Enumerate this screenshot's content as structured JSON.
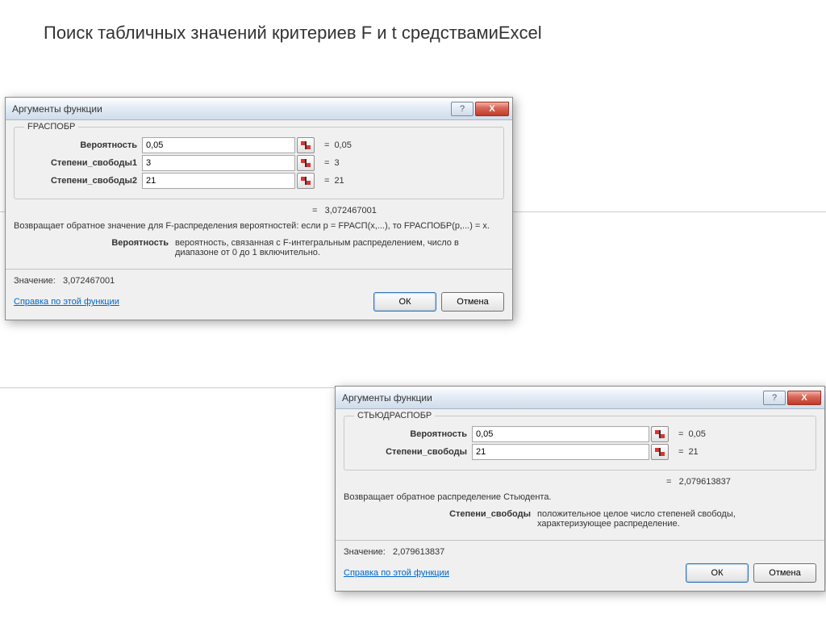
{
  "page_title": "Поиск табличных значений критериев F и t средствамиExcel",
  "dialog1": {
    "title": "Аргументы функции",
    "help_btn": "?",
    "close_btn": "X",
    "func_name": "FРАСПОБР",
    "args": [
      {
        "label": "Вероятность",
        "value": "0,05",
        "eval": "0,05"
      },
      {
        "label": "Степени_свободы1",
        "value": "3",
        "eval": "3"
      },
      {
        "label": "Степени_свободы2",
        "value": "21",
        "eval": "21"
      }
    ],
    "result_eq": "=",
    "result_inline": "3,072467001",
    "description": "Возвращает обратное значение для F-распределения вероятностей: если p = FРАСП(x,...), то FРАСПОБР(p,...) = x.",
    "param_help_label": "Вероятность",
    "param_help_text": "вероятность, связанная с F-интегральным распределением, число в диапазоне от 0 до 1 включительно.",
    "value_label": "Значение:",
    "value": "3,072467001",
    "help_link": "Справка по этой функции",
    "ok": "ОК",
    "cancel": "Отмена"
  },
  "dialog2": {
    "title": "Аргументы функции",
    "help_btn": "?",
    "close_btn": "X",
    "func_name": "СТЬЮДРАСПОБР",
    "args": [
      {
        "label": "Вероятность",
        "value": "0,05",
        "eval": "0,05"
      },
      {
        "label": "Степени_свободы",
        "value": "21",
        "eval": "21"
      }
    ],
    "result_eq": "=",
    "result_inline": "2,079613837",
    "description": "Возвращает обратное распределение Стьюдента.",
    "param_help_label": "Степени_свободы",
    "param_help_text": "положительное целое число степеней свободы, характеризующее распределение.",
    "value_label": "Значение:",
    "value": "2,079613837",
    "help_link": "Справка по этой функции",
    "ok": "ОК",
    "cancel": "Отмена"
  }
}
